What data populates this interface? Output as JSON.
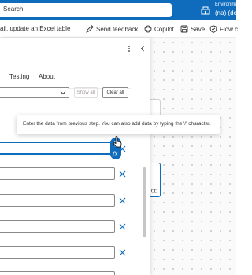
{
  "header": {
    "search_label": "Search",
    "environment_label": "Environments",
    "environment_name": "(na) (default)"
  },
  "command_bar": {
    "flow_title": "ail, update an Excel table",
    "send_feedback": "Send feedback",
    "copilot": "Copilot",
    "save": "Save",
    "flow_checker": "Flow c"
  },
  "panel": {
    "tabs": [
      "Testing",
      "About"
    ],
    "dropdown_value": "",
    "show_all_label": "Show all",
    "clear_all_label": "Clear all",
    "fields": [
      "",
      "",
      "",
      "",
      "",
      ""
    ]
  },
  "tooltip": {
    "text": "Enter the data from previous step. You can also add data by typing the '/' character."
  },
  "colors": {
    "brand": "#0f6cbd",
    "remove_icon": "#0f6cbd",
    "canvas": "#fafafa"
  },
  "icons": {
    "header": [
      "environment-icon"
    ],
    "commands": [
      "feedback-icon",
      "copilot-icon",
      "save-icon",
      "flow-checker-icon"
    ],
    "panel": [
      "more-icon",
      "collapse-icon",
      "chevron-down-icon",
      "dismiss-icon",
      "lightning-icon",
      "fx-icon"
    ]
  }
}
